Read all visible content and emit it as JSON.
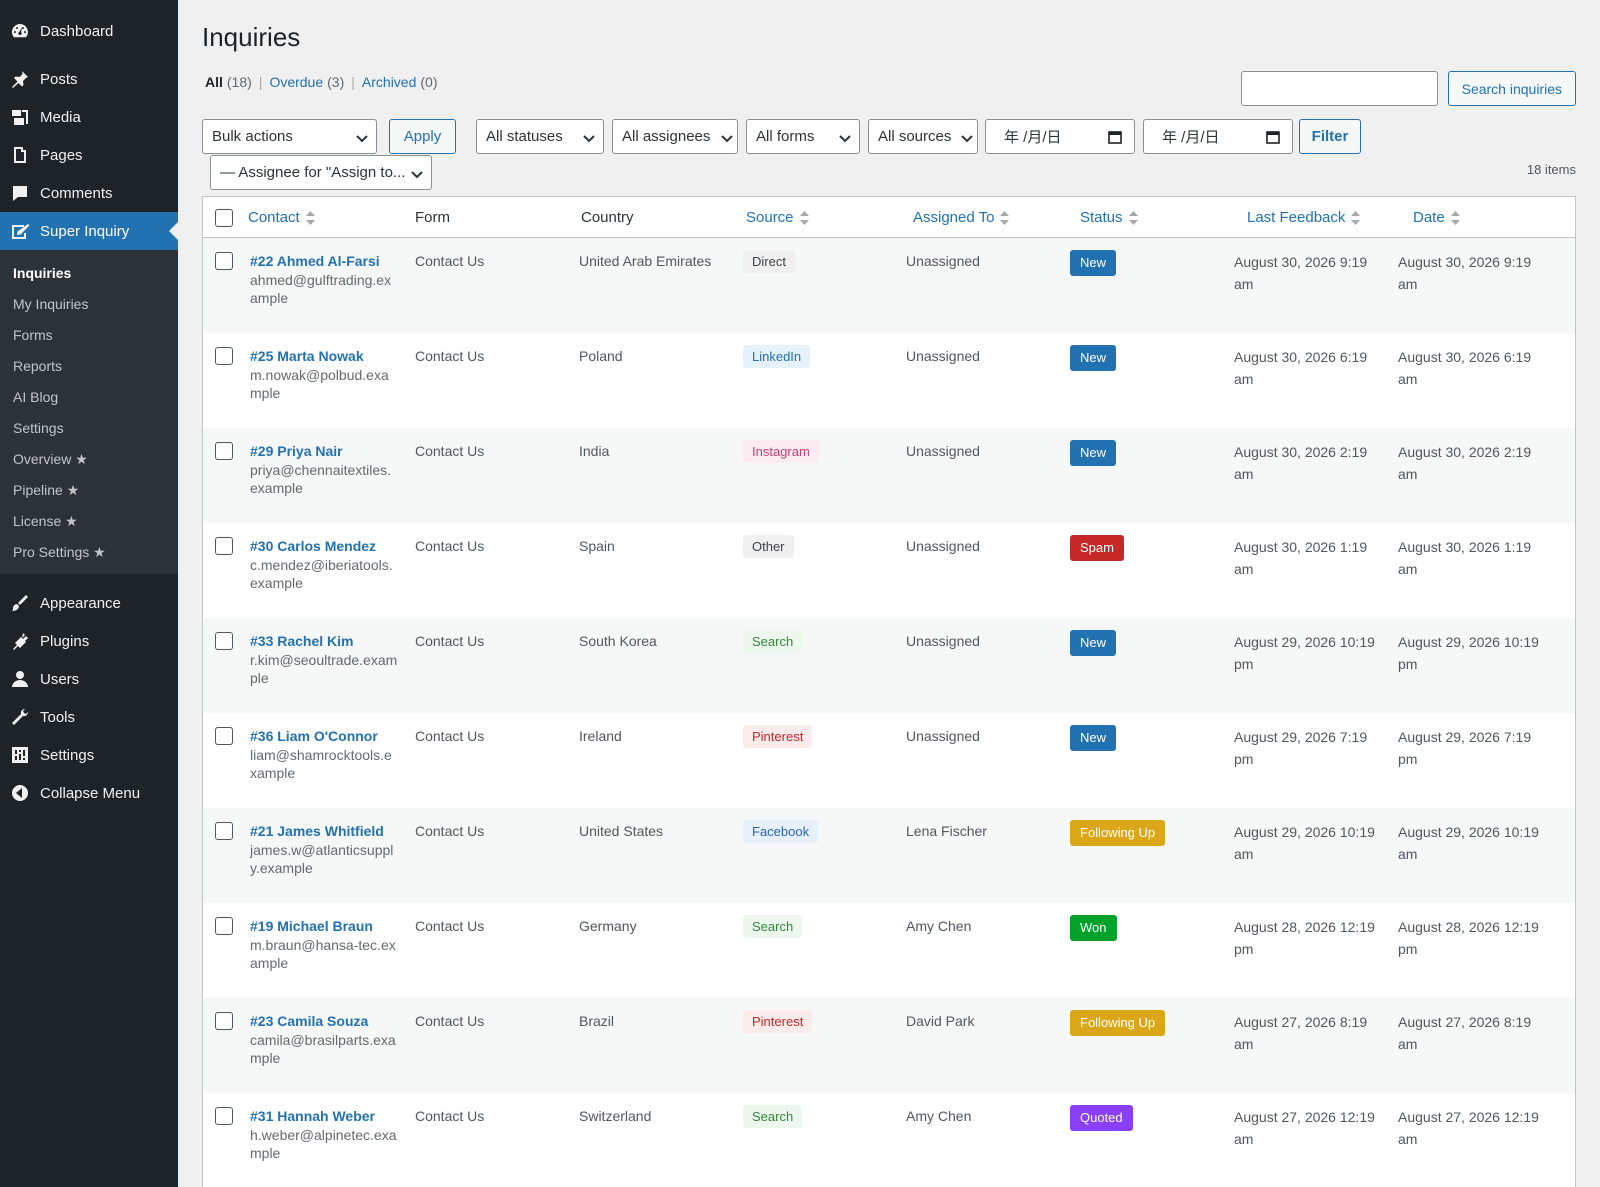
{
  "sidebar": {
    "items_top": [
      {
        "label": "Dashboard",
        "icon": "dashboard-icon"
      },
      {
        "label": "Posts",
        "icon": "pin-icon"
      },
      {
        "label": "Media",
        "icon": "media-icon"
      },
      {
        "label": "Pages",
        "icon": "pages-icon"
      },
      {
        "label": "Comments",
        "icon": "comments-icon"
      },
      {
        "label": "Super Inquiry",
        "icon": "inquiry-icon"
      }
    ],
    "submenu": [
      "Inquiries",
      "My Inquiries",
      "Forms",
      "Reports",
      "AI Blog",
      "Settings",
      "Overview ★",
      "Pipeline ★",
      "License ★",
      "Pro Settings ★"
    ],
    "items_bottom": [
      {
        "label": "Appearance",
        "icon": "brush-icon"
      },
      {
        "label": "Plugins",
        "icon": "plugin-icon"
      },
      {
        "label": "Users",
        "icon": "user-icon"
      },
      {
        "label": "Tools",
        "icon": "wrench-icon"
      },
      {
        "label": "Settings",
        "icon": "settings-icon"
      },
      {
        "label": "Collapse Menu",
        "icon": "collapse-icon"
      }
    ]
  },
  "page": {
    "title": "Inquiries",
    "views": [
      {
        "label": "All",
        "count": "(18)"
      },
      {
        "label": "Overdue",
        "count": "(3)"
      },
      {
        "label": "Archived",
        "count": "(0)"
      }
    ],
    "search_button": "Search inquiries",
    "search_value": "",
    "filters": {
      "bulk_actions": "Bulk actions",
      "apply": "Apply",
      "statuses": "All statuses",
      "assignees": "All assignees",
      "forms": "All forms",
      "sources": "All sources",
      "date_from": "年 /月/日",
      "date_to": "年 /月/日",
      "filter": "Filter",
      "assign_to": "— Assignee for \"Assign to..."
    },
    "items_count": "18 items"
  },
  "table": {
    "headers": {
      "contact": "Contact",
      "form": "Form",
      "country": "Country",
      "source": "Source",
      "assigned": "Assigned To",
      "status": "Status",
      "last_feedback": "Last Feedback",
      "date": "Date"
    },
    "source_colors": {
      "Direct": {
        "bg": "#f0f0f1",
        "fg": "#3c434a"
      },
      "LinkedIn": {
        "bg": "#e5f1fb",
        "fg": "#2271b1"
      },
      "Instagram": {
        "bg": "#fcecf1",
        "fg": "#c2416c"
      },
      "Other": {
        "bg": "#f0f0f1",
        "fg": "#3c434a"
      },
      "Search": {
        "bg": "#edf7ee",
        "fg": "#2f8a3b"
      },
      "Pinterest": {
        "bg": "#fcebeb",
        "fg": "#c62828"
      },
      "Facebook": {
        "bg": "#e8f0fb",
        "fg": "#2863b8"
      }
    },
    "status_colors": {
      "New": "#2271b1",
      "Spam": "#c62828",
      "Following Up": "#dba617",
      "Won": "#00a32a",
      "Quoted": "#8a3ffc"
    },
    "rows": [
      {
        "name": "#22 Ahmed Al-Farsi",
        "email": "ahmed@gulftrading.example",
        "form": "Contact Us",
        "country": "United Arab Emirates",
        "source": "Direct",
        "assigned": "Unassigned",
        "status": "New",
        "last_feedback": "August 30, 2026 9:19 am",
        "date": "August 30, 2026 9:19 am"
      },
      {
        "name": "#25 Marta Nowak",
        "email": "m.nowak@polbud.example",
        "form": "Contact Us",
        "country": "Poland",
        "source": "LinkedIn",
        "assigned": "Unassigned",
        "status": "New",
        "last_feedback": "August 30, 2026 6:19 am",
        "date": "August 30, 2026 6:19 am"
      },
      {
        "name": "#29 Priya Nair",
        "email": "priya@chennaitextiles.example",
        "form": "Contact Us",
        "country": "India",
        "source": "Instagram",
        "assigned": "Unassigned",
        "status": "New",
        "last_feedback": "August 30, 2026 2:19 am",
        "date": "August 30, 2026 2:19 am"
      },
      {
        "name": "#30 Carlos Mendez",
        "email": "c.mendez@iberiatools.example",
        "form": "Contact Us",
        "country": "Spain",
        "source": "Other",
        "assigned": "Unassigned",
        "status": "Spam",
        "last_feedback": "August 30, 2026 1:19 am",
        "date": "August 30, 2026 1:19 am"
      },
      {
        "name": "#33 Rachel Kim",
        "email": "r.kim@seoultrade.example",
        "form": "Contact Us",
        "country": "South Korea",
        "source": "Search",
        "assigned": "Unassigned",
        "status": "New",
        "last_feedback": "August 29, 2026 10:19 pm",
        "date": "August 29, 2026 10:19 pm"
      },
      {
        "name": "#36 Liam O'Connor",
        "email": "liam@shamrocktools.example",
        "form": "Contact Us",
        "country": "Ireland",
        "source": "Pinterest",
        "assigned": "Unassigned",
        "status": "New",
        "last_feedback": "August 29, 2026 7:19 pm",
        "date": "August 29, 2026 7:19 pm"
      },
      {
        "name": "#21 James Whitfield",
        "email": "james.w@atlanticsupply.example",
        "form": "Contact Us",
        "country": "United States",
        "source": "Facebook",
        "assigned": "Lena Fischer",
        "status": "Following Up",
        "last_feedback": "August 29, 2026 10:19 am",
        "date": "August 29, 2026 10:19 am"
      },
      {
        "name": "#19 Michael Braun",
        "email": "m.braun@hansa-tec.example",
        "form": "Contact Us",
        "country": "Germany",
        "source": "Search",
        "assigned": "Amy Chen",
        "status": "Won",
        "last_feedback": "August 28, 2026 12:19 pm",
        "date": "August 28, 2026 12:19 pm"
      },
      {
        "name": "#23 Camila Souza",
        "email": "camila@brasilparts.example",
        "form": "Contact Us",
        "country": "Brazil",
        "source": "Pinterest",
        "assigned": "David Park",
        "status": "Following Up",
        "last_feedback": "August 27, 2026 8:19 am",
        "date": "August 27, 2026 8:19 am"
      },
      {
        "name": "#31 Hannah Weber",
        "email": "h.weber@alpinetec.example",
        "form": "Contact Us",
        "country": "Switzerland",
        "source": "Search",
        "assigned": "Amy Chen",
        "status": "Quoted",
        "last_feedback": "August 27, 2026 12:19 am",
        "date": "August 27, 2026 12:19 am"
      }
    ]
  }
}
